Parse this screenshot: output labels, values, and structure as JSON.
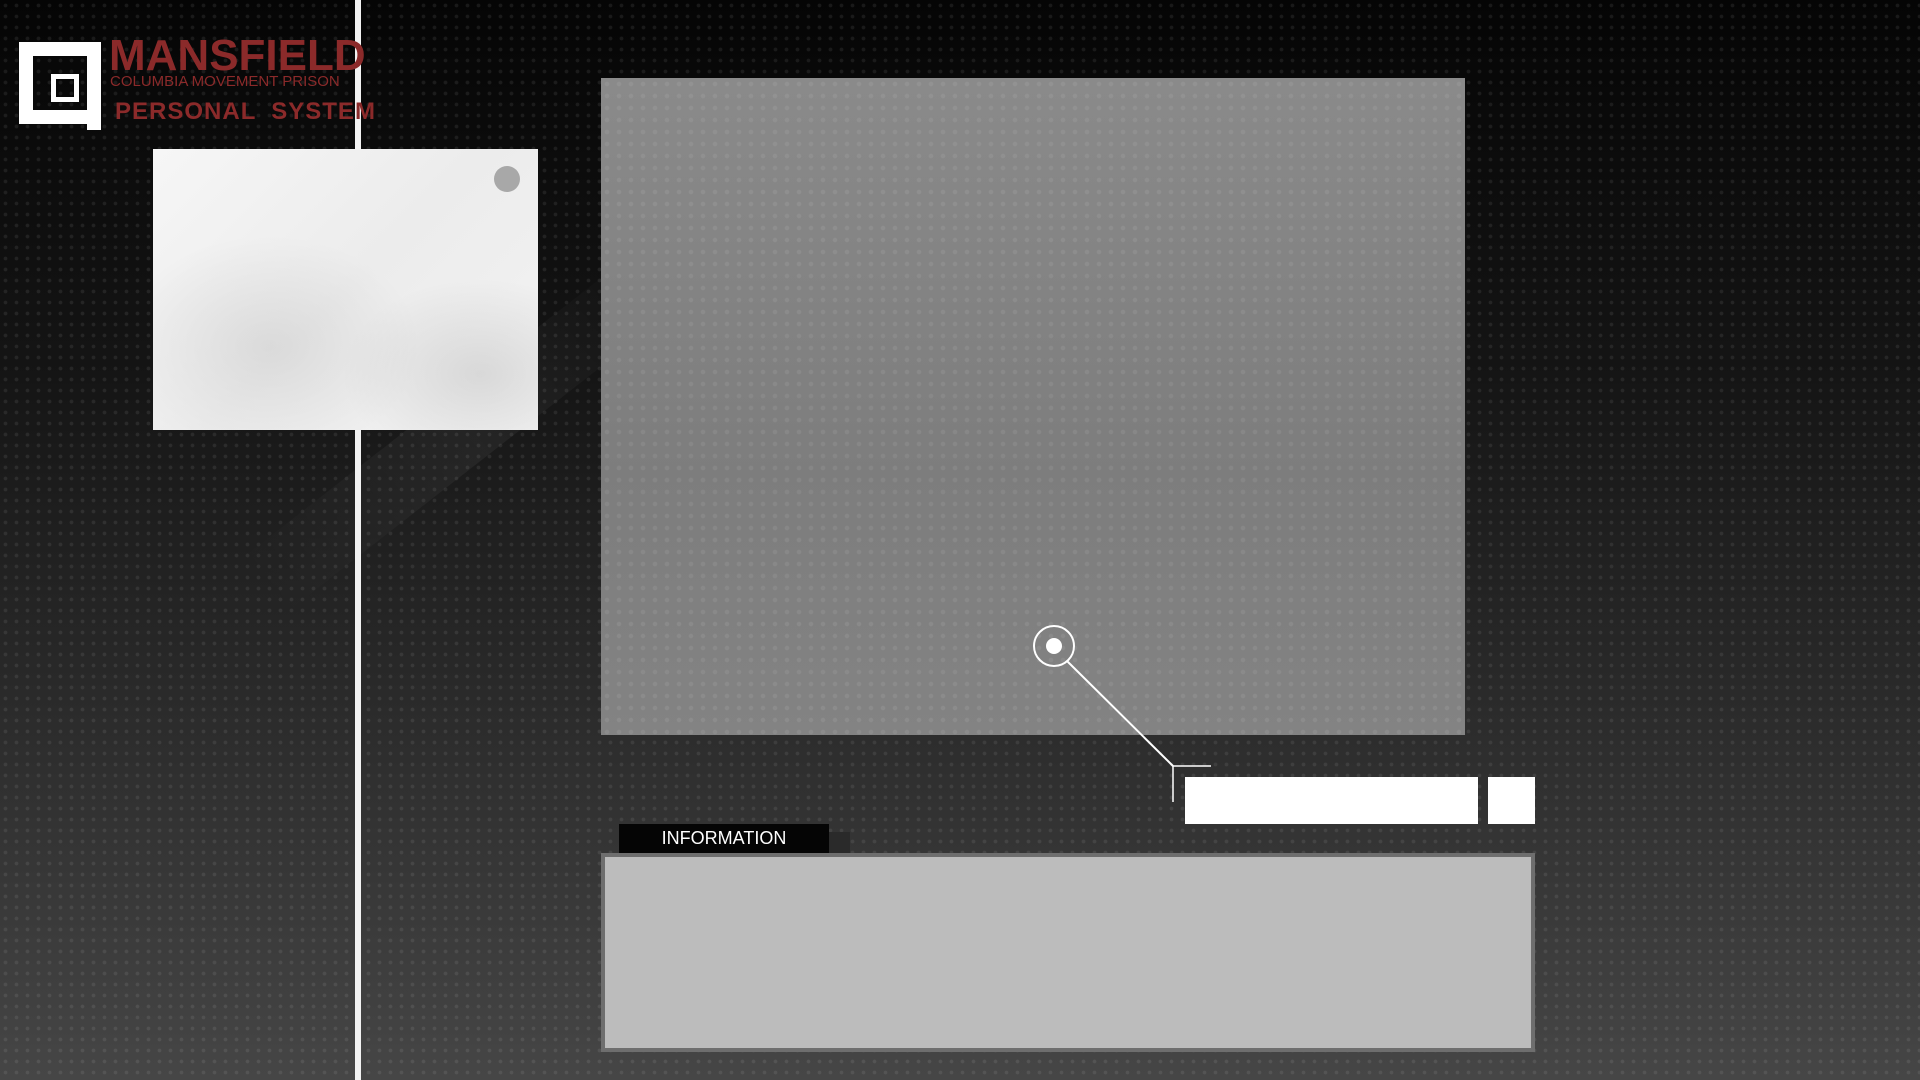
{
  "header": {
    "logo_title": "MANSFIELD",
    "logo_subtitle": "COLUMBIA MOVEMENT PRISON",
    "logo_system": "PERSONAL  SYSTEM"
  },
  "information": {
    "tab_label": "INFORMATION",
    "content": ""
  },
  "fields": {
    "name_value": "",
    "small_value": ""
  },
  "colors": {
    "brand_red": "#8b2a2a",
    "panel_gray": "#808080",
    "info_panel": "#bcbcbc",
    "accent_white": "#ffffff"
  },
  "icons": {
    "logo": "mansfield-logo-icon",
    "marker": "target-marker-icon",
    "portrait_dot": "circle-dot-icon"
  }
}
